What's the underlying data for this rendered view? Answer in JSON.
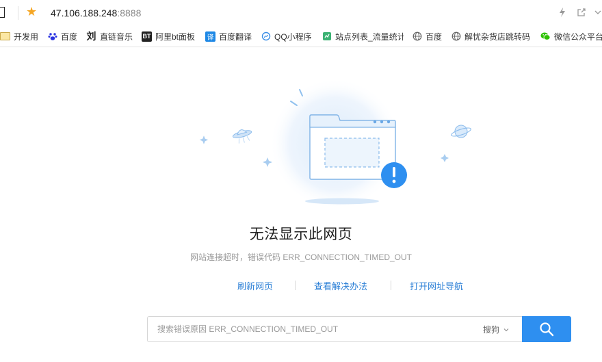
{
  "address_bar": {
    "url_host": "47.106.188.248",
    "url_port": ":8888"
  },
  "bookmarks": [
    {
      "label": "开发用",
      "icon": "folder-icon"
    },
    {
      "label": "百度",
      "icon": "baidu-paw-icon"
    },
    {
      "label": "直链音乐",
      "icon": "liu-character-icon",
      "icon_text": "刘"
    },
    {
      "label": "阿里bt面板",
      "icon": "bt-icon",
      "icon_text": "BT"
    },
    {
      "label": "百度翻译",
      "icon": "translate-icon",
      "icon_text": "译"
    },
    {
      "label": "QQ小程序",
      "icon": "qq-miniprogram-icon"
    },
    {
      "label": "站点列表_流量统计",
      "icon": "site-stats-icon"
    },
    {
      "label": "百度",
      "icon": "globe-icon"
    },
    {
      "label": "解忧杂货店跳转码",
      "icon": "globe-icon"
    },
    {
      "label": "微信公众平台",
      "icon": "wechat-icon"
    }
  ],
  "error": {
    "title": "无法显示此网页",
    "subtitle": "网站连接超时，错误代码 ERR_CONNECTION_TIMED_OUT"
  },
  "actions": {
    "refresh": "刷新网页",
    "solutions": "查看解决办法",
    "open_nav": "打开网址导航"
  },
  "search": {
    "placeholder": "搜索错误原因 ERR_CONNECTION_TIMED_OUT",
    "value": "",
    "engine": "搜狗"
  },
  "colors": {
    "accent_blue": "#2e8ff0",
    "link_blue": "#2b7fd6",
    "star": "#f5a623"
  }
}
